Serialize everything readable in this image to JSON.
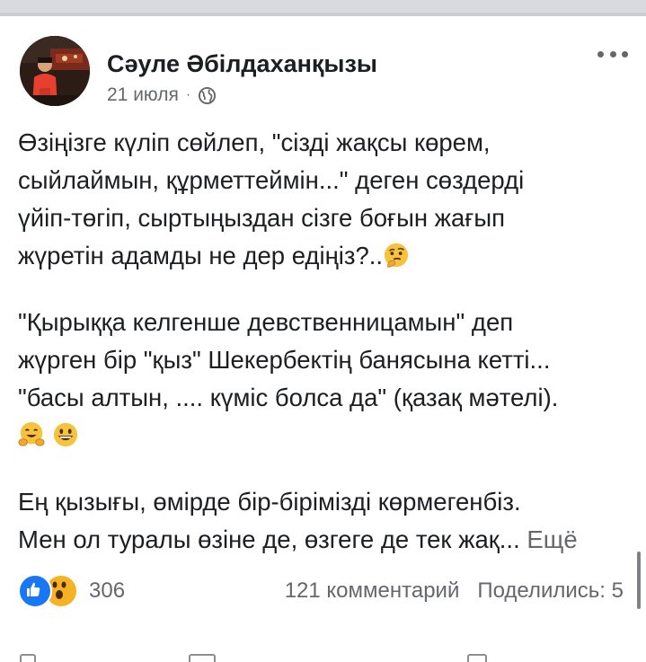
{
  "post": {
    "author": "Сәуле Әбілдаханқызы",
    "date": "21 июля",
    "dot": "·",
    "privacy_icon": "globe-icon",
    "more_icon": "ellipsis-icon",
    "paragraph1": [
      "Өзіңізге күліп сөйлеп, \"сізді жақсы көрем,",
      "сыйлаймын, құрметтеймін...\" деген сөздерді",
      "үйіп-төгіп, сыртыңыздан сізге боғын жағып",
      "жүретін адамды не дер едіңіз?.."
    ],
    "paragraph2": [
      "\"Қырыққа келгенше девственницамын\" деп",
      "жүрген бір \"қыз\" Шекербектің банясына кетті...",
      "\"басы алтын, .... күміс болса да\" (қазақ мәтелі)."
    ],
    "paragraph3": [
      "Ең қызығы, өмірде бір-бірімізді көрмегенбіз.",
      "Мен ол туралы өзіне де, өзгеге де тек жақ..."
    ],
    "see_more": "Ещё",
    "emojis": [
      "thinking-face-emoji",
      "hugging-face-emoji",
      "grinning-face-emoji"
    ]
  },
  "footer": {
    "reaction_icons": [
      "like-icon",
      "wow-icon"
    ],
    "reaction_count": "306",
    "comments": "121 комментарий",
    "shares": "Поделились: 5"
  },
  "colors": {
    "text": "#1c1e21",
    "secondary": "#65676b",
    "like_blue": "#1877f2",
    "wow_yellow": "#f7b125"
  }
}
